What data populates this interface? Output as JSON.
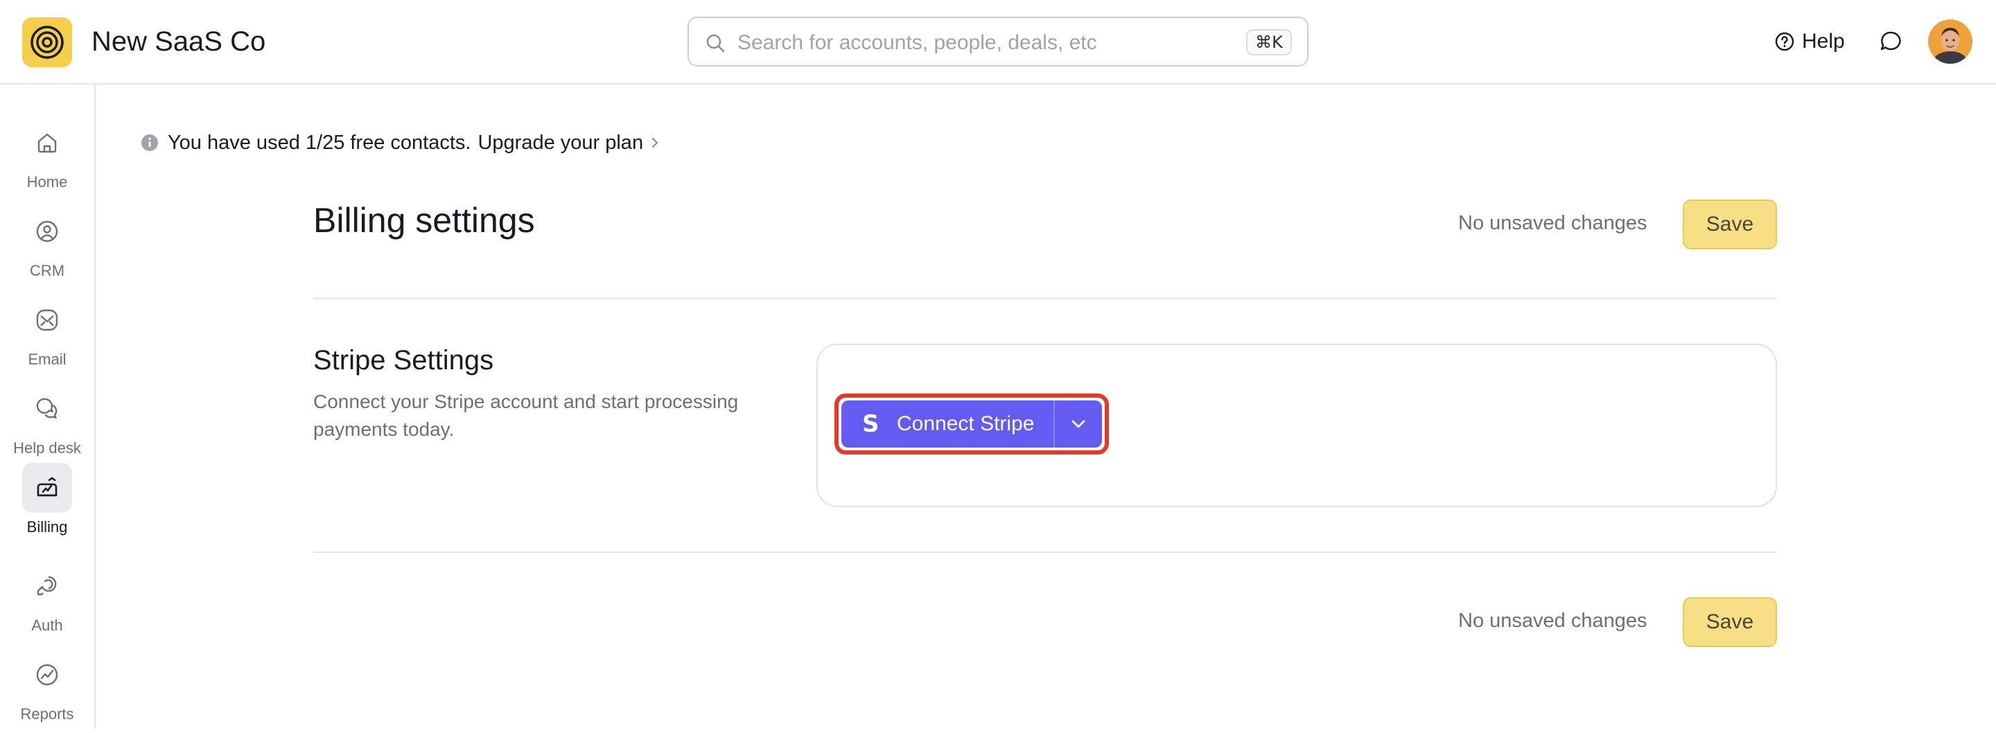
{
  "header": {
    "app_name": "New SaaS Co",
    "search_placeholder": "Search for accounts, people, deals, etc",
    "search_shortcut": "⌘K",
    "help_label": "Help"
  },
  "sidebar": {
    "items": [
      {
        "label": "Home",
        "icon": "home-icon"
      },
      {
        "label": "CRM",
        "icon": "crm-icon"
      },
      {
        "label": "Email",
        "icon": "email-icon"
      },
      {
        "label": "Help desk",
        "icon": "help-desk-icon"
      },
      {
        "label": "Billing",
        "icon": "billing-icon",
        "active": true
      },
      {
        "label": "Auth",
        "icon": "auth-icon"
      },
      {
        "label": "Reports",
        "icon": "reports-icon"
      }
    ]
  },
  "notice": {
    "text": "You have used 1/25 free contacts.",
    "link": "Upgrade your plan"
  },
  "page": {
    "title": "Billing settings",
    "status": "No unsaved changes",
    "save_label": "Save"
  },
  "stripe": {
    "title": "Stripe Settings",
    "description": "Connect your Stripe account and start processing payments today.",
    "connect_label": "Connect Stripe",
    "brand_color": "#635bf2",
    "highlight_color": "#e53a2a"
  },
  "footer": {
    "status": "No unsaved changes",
    "save_label": "Save"
  },
  "colors": {
    "accent_yellow": "#f5cf4a",
    "save_button": "#f7df86"
  }
}
